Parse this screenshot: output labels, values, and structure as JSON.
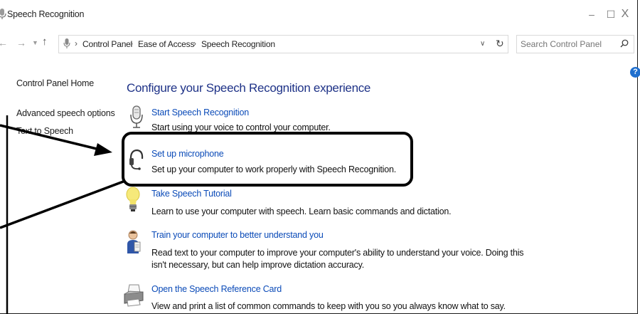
{
  "window": {
    "title": "Speech Recognition",
    "controls": {
      "minimize": "–",
      "maximize": "☐",
      "close": "X"
    }
  },
  "address_bar": {
    "breadcrumbs": [
      "Control Panel",
      "Ease of Access",
      "Speech Recognition"
    ],
    "separator": "›"
  },
  "search": {
    "placeholder": "Search Control Panel"
  },
  "help": {
    "label": "?"
  },
  "sidebar": {
    "items": [
      {
        "label": "Control Panel Home"
      },
      {
        "label": "Advanced speech options"
      },
      {
        "label": "Text to Speech"
      }
    ]
  },
  "main": {
    "heading": "Configure your Speech Recognition experience",
    "tasks": [
      {
        "link": "Start Speech Recognition",
        "desc": [
          "Start using your voice to control your computer."
        ],
        "icon": "microphone-icon"
      },
      {
        "link": "Set up microphone",
        "desc": [
          "Set up your computer to work properly with Speech Recognition."
        ],
        "icon": "headset-icon"
      },
      {
        "link": "Take Speech Tutorial",
        "desc": [
          "Learn to use your computer with speech.  Learn basic commands and dictation."
        ],
        "icon": "lightbulb-icon"
      },
      {
        "link": "Train your computer to better understand you",
        "desc": [
          "Read text to your computer to improve your computer's ability to understand your voice.  Doing this",
          "isn't necessary, but can help improve dictation accuracy."
        ],
        "icon": "person-icon"
      },
      {
        "link": "Open the Speech Reference Card",
        "desc": [
          "View and print a list of common commands to keep with you so you always know what to say."
        ],
        "icon": "printer-icon"
      }
    ]
  },
  "annotation": {
    "highlight": "Set up microphone"
  }
}
